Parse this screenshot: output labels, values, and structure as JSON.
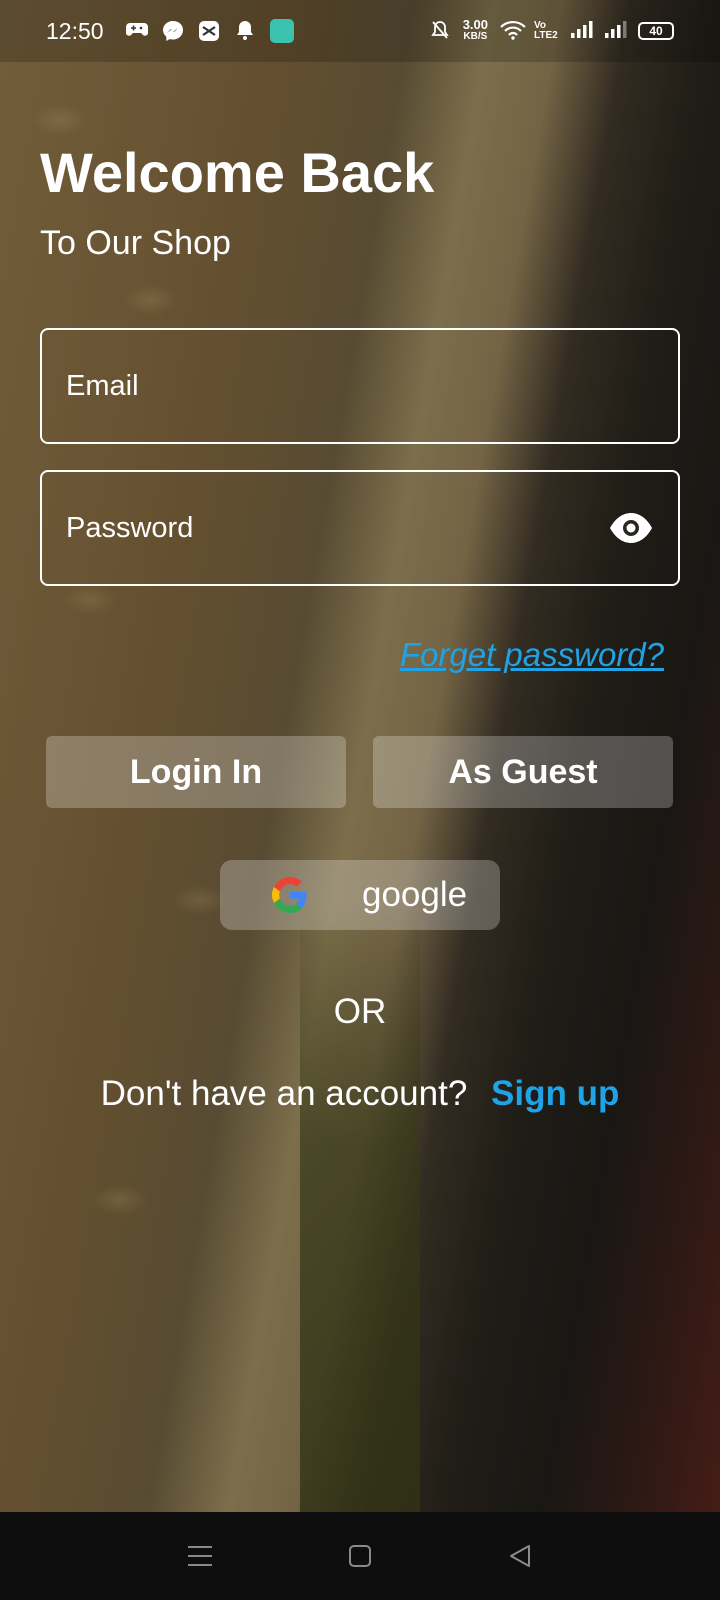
{
  "status_bar": {
    "time": "12:50",
    "net_speed": "3.00",
    "net_speed_unit": "KB/S",
    "volte": "Vo LTE2",
    "battery": "40",
    "icons_left": [
      "game-controller-icon",
      "messenger-icon",
      "capcut-icon",
      "bell-icon",
      "app-icon"
    ],
    "icons_right": [
      "mute-icon",
      "wifi-icon",
      "signal-icon",
      "signal-icon",
      "battery-icon"
    ]
  },
  "header": {
    "title": "Welcome Back",
    "subtitle": "To Our Shop"
  },
  "form": {
    "email_placeholder": "Email",
    "password_placeholder": "Password",
    "forgot_label": "Forget password?"
  },
  "actions": {
    "login_label": "Login In",
    "guest_label": "As Guest",
    "google_label": "google",
    "or_text": "OR",
    "signup_prompt": "Don't have an account?",
    "signup_link": "Sign up"
  },
  "colors": {
    "accent": "#1fa3e6",
    "nav_bg": "#0e0e0e"
  }
}
